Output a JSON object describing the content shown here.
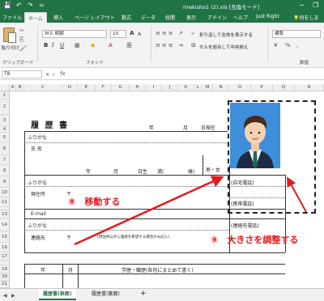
{
  "window": {
    "title": "rirekisho1 (2).xls [互換モード]",
    "min_symbol": "─",
    "restore_symbol": "❐"
  },
  "quick_access": {
    "save": "💾",
    "undo": "↶",
    "redo": "↷",
    "more": "="
  },
  "ribbon": {
    "tabs": [
      "ファイル",
      "ホーム",
      "挿入",
      "ページ レイアウト",
      "数式",
      "データ",
      "校閲",
      "表示",
      "アドイン",
      "ヘルプ",
      "Just Right"
    ],
    "active_tab": "ホーム",
    "tell_me": "何をしま"
  },
  "clipboard": {
    "paste": "貼り付け",
    "group": "クリップボード"
  },
  "font": {
    "name": "ＭＳ 明朝",
    "size": "10",
    "grow": "A",
    "shrink": "A",
    "bold": "B",
    "italic": "I",
    "underline": "U",
    "group": "フォント"
  },
  "alignment": {
    "wrap_text": "折り返して全体を表示する",
    "merge_center": "セルを結合して中央揃え"
  },
  "number": {
    "format": "標準",
    "group": "数値",
    "percent": "%"
  },
  "formula_bar": {
    "name_box": "T8",
    "fx": "fx"
  },
  "columns": [
    "A",
    "B",
    "C",
    "D",
    "E",
    "F",
    "G",
    "H",
    "I",
    "J",
    "K",
    "L",
    "M",
    "N",
    "O",
    "P",
    "Q",
    "R"
  ],
  "rows": [
    "1",
    "2",
    "3",
    "4",
    "5",
    "6",
    "7",
    "8",
    "9",
    "10",
    "11",
    "12",
    "13",
    "14",
    "15",
    "16",
    "17",
    "18",
    "19",
    "20",
    "21"
  ],
  "resume": {
    "title": "履 歴 書",
    "year": "年",
    "month": "月",
    "date_now": "日現在",
    "furigana": "ふりがな",
    "name": "氏 名",
    "birth_year": "年",
    "birth_month": "月",
    "birth_day": "日生",
    "age_open": "満(",
    "age_close": "歳)",
    "gender": "男・女",
    "furigana2": "ふりがな",
    "address": "現住所",
    "postal": "〒",
    "home_phone": "(自宅電話)",
    "mobile_phone": "(携帯電話)",
    "email": "E-mail",
    "furigana3": "ふりがな",
    "contact": "連絡先",
    "postal2": "〒",
    "contact_note": "(現住所以外に連絡を希望する場合のみ記入)",
    "contact_phone": "(連絡先電話)",
    "hist_year": "年",
    "hist_month": "月",
    "hist_header": "学歴・職歴(各別にまとめて書く)"
  },
  "annotations": {
    "a8": "⑧　移動する",
    "a9": "⑨　大きさを調整する"
  },
  "sheets": [
    "履歴書(表面)",
    "履歴書(裏面)"
  ],
  "active_sheet": "履歴書(表面)",
  "add_sheet": "+",
  "colors": {
    "accent": "#217346",
    "annotation": "#e31a1c",
    "photo_bg": "#3f8edb"
  }
}
